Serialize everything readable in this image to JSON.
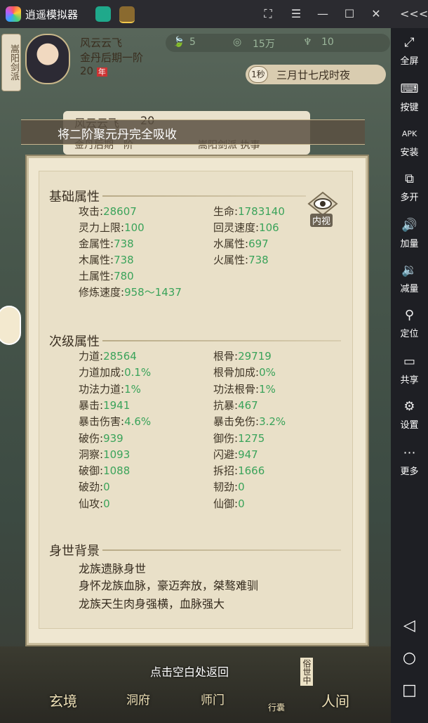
{
  "window": {
    "app_title": "逍遥模拟器",
    "controls": [
      "⛶",
      "☰",
      "—",
      "☐",
      "✕",
      "<<<"
    ]
  },
  "sidebar": {
    "items": [
      {
        "label": "全屏",
        "icon": "fullscreen-icon",
        "glyph": "⤢"
      },
      {
        "label": "按键",
        "icon": "keyboard-icon",
        "glyph": "⌨"
      },
      {
        "label": "安装",
        "icon": "apk-icon",
        "glyph": "APK"
      },
      {
        "label": "多开",
        "icon": "multi-instance-icon",
        "glyph": "⧉"
      },
      {
        "label": "加量",
        "icon": "volume-up-icon",
        "glyph": "🔊"
      },
      {
        "label": "减量",
        "icon": "volume-down-icon",
        "glyph": "🔉"
      },
      {
        "label": "定位",
        "icon": "location-icon",
        "glyph": "⚲"
      },
      {
        "label": "共享",
        "icon": "folder-icon",
        "glyph": "▭"
      },
      {
        "label": "设置",
        "icon": "gear-icon",
        "glyph": "⚙"
      },
      {
        "label": "更多",
        "icon": "more-icon",
        "glyph": "⋯"
      }
    ],
    "nav": {
      "back": "◁",
      "home": "○",
      "recent": "□"
    }
  },
  "header": {
    "sect": "嵩阳剑派",
    "player_name": "风云云飞",
    "realm": "金丹后期一阶",
    "level": "20",
    "level_badge": "年",
    "resources": [
      {
        "icon": "leaf-icon",
        "value": "5"
      },
      {
        "icon": "coin-icon",
        "value": "15万"
      },
      {
        "icon": "ingot-icon",
        "value": "10"
      }
    ],
    "time_speed": "1秒",
    "calendar": "三月廿七戌时夜"
  },
  "toast": {
    "text": "将二阶聚元丹完全吸收"
  },
  "card": {
    "name": "风云云飞",
    "level": "20",
    "realm": "金丹后期一阶",
    "sect_role": "嵩阳剑派 执事"
  },
  "inspect": {
    "label": "内视"
  },
  "basic": {
    "title": "基础属性",
    "rows": [
      [
        {
          "k": "攻击",
          "v": "28607"
        },
        {
          "k": "生命",
          "v": "1783140"
        }
      ],
      [
        {
          "k": "灵力上限",
          "v": "100"
        },
        {
          "k": "回灵速度",
          "v": "106"
        }
      ],
      [
        {
          "k": "金属性",
          "v": "738"
        },
        {
          "k": "水属性",
          "v": "697"
        }
      ],
      [
        {
          "k": "木属性",
          "v": "738"
        },
        {
          "k": "火属性",
          "v": "738"
        }
      ],
      [
        {
          "k": "土属性",
          "v": "780"
        },
        null
      ],
      [
        {
          "k": "修炼速度",
          "v": "958～1437"
        },
        null
      ]
    ]
  },
  "secondary": {
    "title": "次级属性",
    "rows": [
      [
        {
          "k": "力道",
          "v": "28564"
        },
        {
          "k": "根骨",
          "v": "29719"
        }
      ],
      [
        {
          "k": "力道加成",
          "v": "0.1%"
        },
        {
          "k": "根骨加成",
          "v": "0%"
        }
      ],
      [
        {
          "k": "功法力道",
          "v": "1%"
        },
        {
          "k": "功法根骨",
          "v": "1%"
        }
      ],
      [
        {
          "k": "暴击",
          "v": "1941"
        },
        {
          "k": "抗暴",
          "v": "467"
        }
      ],
      [
        {
          "k": "暴击伤害",
          "v": "4.6%"
        },
        {
          "k": "暴击免伤",
          "v": "3.2%"
        }
      ],
      [
        {
          "k": "破伤",
          "v": "939"
        },
        {
          "k": "御伤",
          "v": "1275"
        }
      ],
      [
        {
          "k": "洞察",
          "v": "1093"
        },
        {
          "k": "闪避",
          "v": "947"
        }
      ],
      [
        {
          "k": "破御",
          "v": "1088"
        },
        {
          "k": "拆招",
          "v": "1666"
        }
      ],
      [
        {
          "k": "破劲",
          "v": "0"
        },
        {
          "k": "韧劲",
          "v": "0"
        }
      ],
      [
        {
          "k": "仙攻",
          "v": "0"
        },
        {
          "k": "仙御",
          "v": "0"
        }
      ]
    ]
  },
  "background": {
    "title": "身世背景",
    "lines": [
      "龙族遗脉身世",
      "身怀龙族血脉，豪迈奔放，桀骜难驯",
      "龙族天生肉身强横，血脉强大"
    ]
  },
  "footer": {
    "hint": "点击空白处返回",
    "nav": [
      "玄境",
      "洞府",
      "师门",
      "行囊",
      "人间"
    ],
    "badge": "俗世中"
  },
  "colors": {
    "value_green": "#3aa35a",
    "panel_bg": "#efe7d1",
    "sidebar_bg": "#1e1f24"
  }
}
